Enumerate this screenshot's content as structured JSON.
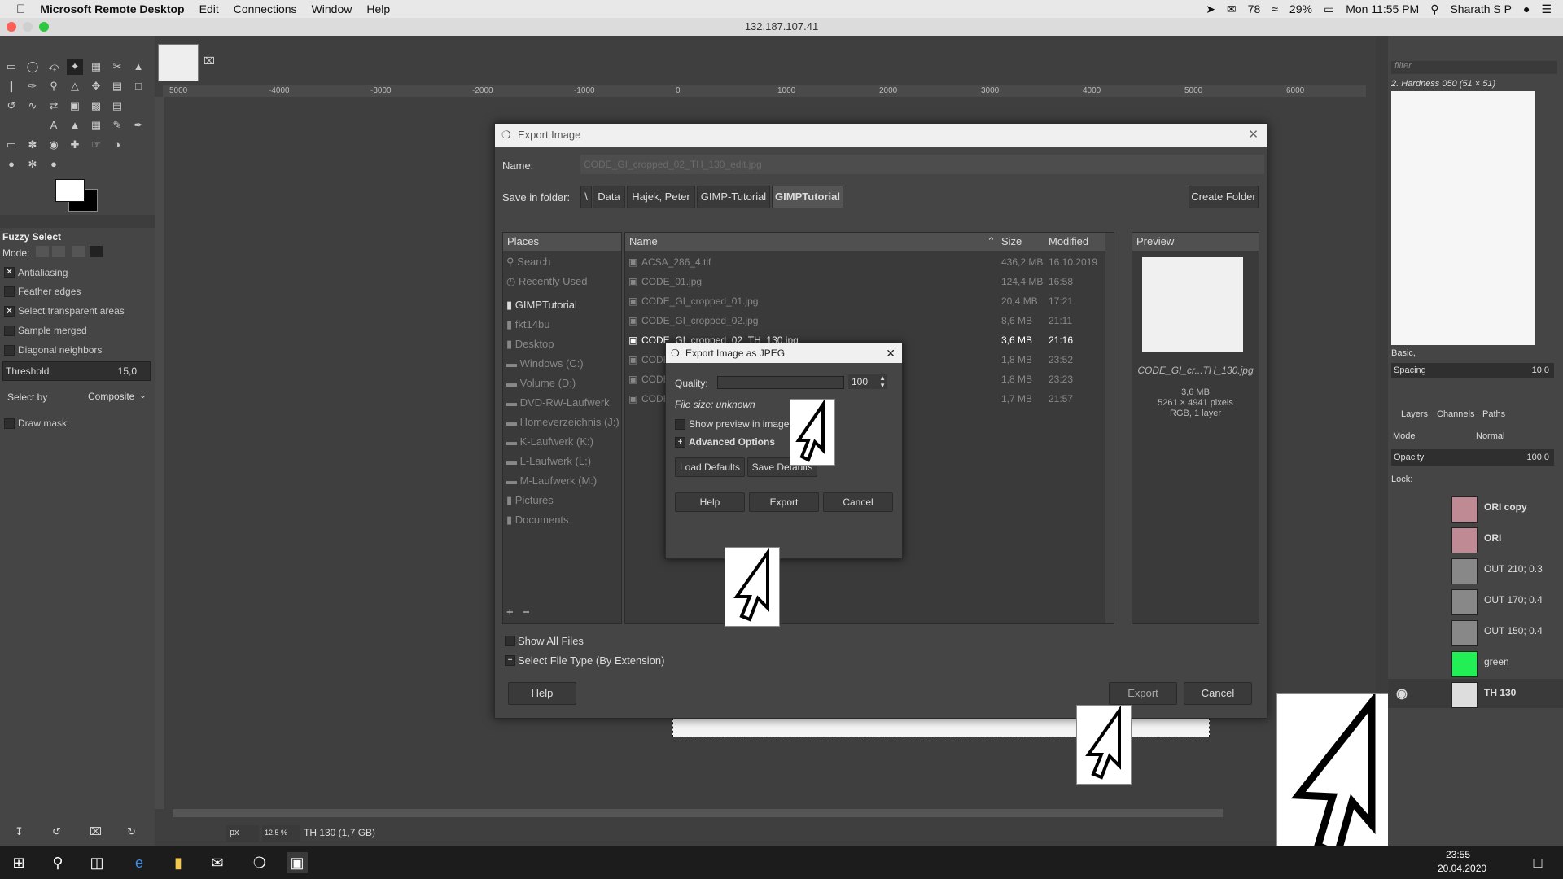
{
  "menubar": {
    "app_name": "Microsoft Remote Desktop",
    "items": [
      "Edit",
      "Connections",
      "Window",
      "Help"
    ],
    "status": {
      "mail_count": "78",
      "battery": "29%",
      "clock": "Mon 11:55 PM",
      "user": "Sharath S P"
    }
  },
  "window": {
    "title": "132.187.107.41"
  },
  "toolbox": {
    "tool_name": "Fuzzy Select",
    "mode_label": "Mode:",
    "antialiasing": "Antialiasing",
    "feather_edges": "Feather edges",
    "select_transparent": "Select transparent areas",
    "sample_merged": "Sample merged",
    "diagonal_neighbors": "Diagonal neighbors",
    "threshold_label": "Threshold",
    "threshold_value": "15,0",
    "select_by_label": "Select by",
    "select_by_value": "Composite",
    "draw_mask": "Draw mask"
  },
  "ruler": {
    "ticks": [
      "5000",
      "-4000",
      "-3000",
      "-2000",
      "-1000",
      "0",
      "1000",
      "2000",
      "3000",
      "4000",
      "5000",
      "6000"
    ]
  },
  "statusbar": {
    "unit": "px",
    "zoom": "12.5 %",
    "info": "TH 130 (1,7 GB)"
  },
  "export_dialog": {
    "title": "Export Image",
    "name_label": "Name:",
    "name_value": "CODE_GI_cropped_02_TH_130_edit.jpg",
    "save_in_label": "Save in folder:",
    "crumbs": [
      "\\",
      "Data",
      "Hajek, Peter",
      "GIMP-Tutorial",
      "GIMPTutorial"
    ],
    "create_folder": "Create Folder",
    "places_header": "Places",
    "places": [
      "Search",
      "Recently Used",
      "GIMPTutorial",
      "fkt14bu",
      "Desktop",
      "Windows (C:)",
      "Volume (D:)",
      "DVD-RW-Laufwerk ...",
      "Homeverzeichnis (J:)",
      "K-Laufwerk (K:)",
      "L-Laufwerk (L:)",
      "M-Laufwerk (M:)",
      "Pictures",
      "Documents"
    ],
    "col_name": "Name",
    "col_size": "Size",
    "col_modified": "Modified",
    "files": [
      {
        "name": "ACSA_286_4.tif",
        "size": "436,2 MB",
        "modified": "16.10.2019"
      },
      {
        "name": "CODE_01.jpg",
        "size": "124,4 MB",
        "modified": "16:58"
      },
      {
        "name": "CODE_GI_cropped_01.jpg",
        "size": "20,4 MB",
        "modified": "17:21"
      },
      {
        "name": "CODE_GI_cropped_02.jpg",
        "size": "8,6 MB",
        "modified": "21:11"
      },
      {
        "name": "CODE_GI_cropped_02_TH_130.jpg",
        "size": "3,6 MB",
        "modified": "21:16"
      },
      {
        "name": "CODE",
        "size": "1,8 MB",
        "modified": "23:52"
      },
      {
        "name": "CODE",
        "size": "1,8 MB",
        "modified": "23:23"
      },
      {
        "name": "CODE",
        "size": "1,7 MB",
        "modified": "21:57"
      }
    ],
    "preview_header": "Preview",
    "preview_name": "CODE_GI_cr...TH_130.jpg",
    "preview_size": "3,6 MB",
    "preview_dims": "5261 × 4941 pixels",
    "preview_type": "RGB, 1 layer",
    "show_all_files": "Show All Files",
    "select_file_type": "Select File Type (By Extension)",
    "help": "Help",
    "export": "Export",
    "cancel": "Cancel"
  },
  "jpeg_dialog": {
    "title": "Export Image as JPEG",
    "quality_label": "Quality:",
    "quality_value": "100",
    "quality": 100,
    "file_size": "File size: unknown",
    "show_preview": "Show preview in image window",
    "advanced": "Advanced Options",
    "load_defaults": "Load Defaults",
    "save_defaults": "Save Defaults",
    "help": "Help",
    "export": "Export",
    "cancel": "Cancel"
  },
  "right_dock": {
    "filter_placeholder": "filter",
    "brush_name": "2. Hardness 050 (51 × 51)",
    "brush_set": "Basic,",
    "spacing_label": "Spacing",
    "spacing_value": "10,0",
    "tabs": [
      "Layers",
      "Channels",
      "Paths"
    ],
    "mode_label": "Mode",
    "mode_value": "Normal",
    "opacity_label": "Opacity",
    "opacity_value": "100,0",
    "lock_label": "Lock:",
    "layers": [
      {
        "name": "ORI copy",
        "color": "#c08a94"
      },
      {
        "name": "ORI",
        "color": "#c08a94"
      },
      {
        "name": "OUT 210; 0.3",
        "color": "#888888"
      },
      {
        "name": "OUT 170; 0.4",
        "color": "#888888"
      },
      {
        "name": "OUT 150; 0.4",
        "color": "#888888"
      },
      {
        "name": "green",
        "color": "#22ee55"
      },
      {
        "name": "TH 130",
        "color": "#dddddd"
      }
    ]
  },
  "taskbar": {
    "time": "23:55",
    "date": "20.04.2020"
  }
}
